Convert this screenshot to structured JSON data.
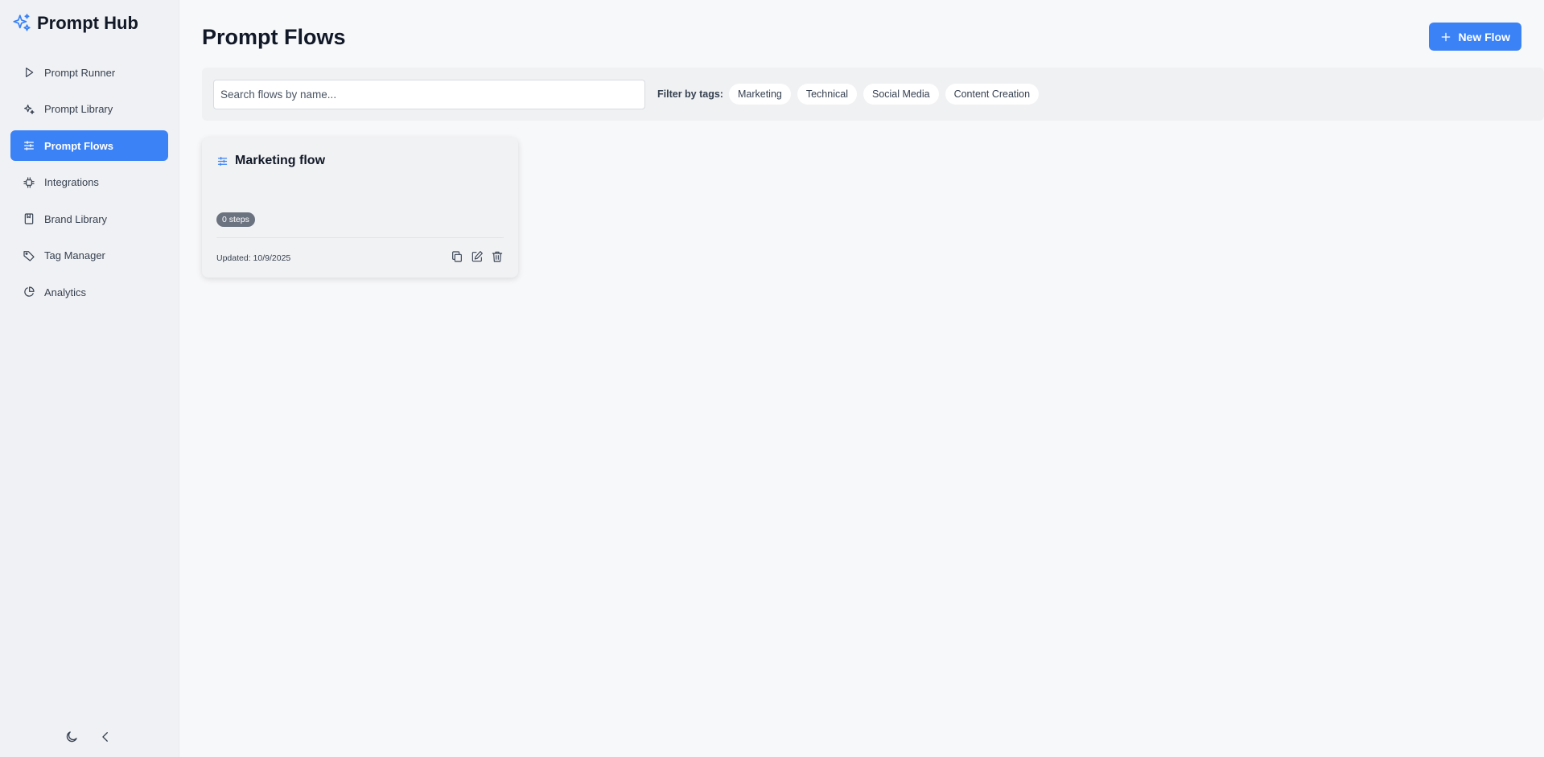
{
  "app": {
    "title": "Prompt Hub",
    "logo_icon": "sparkles-icon",
    "accent": "#3b82f6"
  },
  "sidebar": {
    "items": [
      {
        "label": "Prompt Runner",
        "icon": "play-icon",
        "active": false
      },
      {
        "label": "Prompt Library",
        "icon": "sparkles-icon",
        "active": false
      },
      {
        "label": "Prompt Flows",
        "icon": "sliders-icon",
        "active": true
      },
      {
        "label": "Integrations",
        "icon": "chip-icon",
        "active": false
      },
      {
        "label": "Brand Library",
        "icon": "bookmark-icon",
        "active": false
      },
      {
        "label": "Tag Manager",
        "icon": "tag-icon",
        "active": false
      },
      {
        "label": "Analytics",
        "icon": "pie-chart-icon",
        "active": false
      }
    ],
    "bottom": {
      "theme_icon": "moon-icon",
      "collapse_icon": "chevron-left-icon"
    }
  },
  "main": {
    "title": "Prompt Flows",
    "new_button": "New Flow",
    "search": {
      "placeholder": "Search flows by name...",
      "value": ""
    },
    "filter_label": "Filter by tags:",
    "tags": [
      "Marketing",
      "Technical",
      "Social Media",
      "Content Creation"
    ],
    "flows": [
      {
        "title": "Marketing flow",
        "steps": "0 steps",
        "updated": "Updated: 10/9/2025",
        "actions": [
          "copy-icon",
          "edit-icon",
          "trash-icon"
        ]
      }
    ]
  }
}
